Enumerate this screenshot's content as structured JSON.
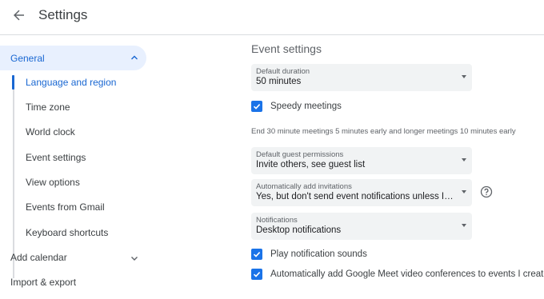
{
  "header": {
    "title": "Settings",
    "back_icon": "arrow-back-icon"
  },
  "sidebar": {
    "section": {
      "label": "General",
      "expanded": true
    },
    "items": [
      {
        "label": "Language and region",
        "active": true
      },
      {
        "label": "Time zone"
      },
      {
        "label": "World clock"
      },
      {
        "label": "Event settings"
      },
      {
        "label": "View options"
      },
      {
        "label": "Events from Gmail"
      },
      {
        "label": "Keyboard shortcuts"
      }
    ],
    "add_calendar": {
      "label": "Add calendar"
    },
    "import_export": {
      "label": "Import & export"
    }
  },
  "main": {
    "section_title": "Event settings",
    "default_duration": {
      "caption": "Default duration",
      "value": "50 minutes"
    },
    "speedy_meetings": {
      "label": "Speedy meetings",
      "checked": true
    },
    "speedy_hint": "End 30 minute meetings 5 minutes early and longer meetings 10 minutes early",
    "guest_permissions": {
      "caption": "Default guest permissions",
      "value": "Invite others, see guest list"
    },
    "auto_invitations": {
      "caption": "Automatically add invitations",
      "value": "Yes, but don't send event notifications unless I ha..."
    },
    "notifications": {
      "caption": "Notifications",
      "value": "Desktop notifications"
    },
    "play_sounds": {
      "label": "Play notification sounds",
      "checked": true
    },
    "auto_meet": {
      "label": "Automatically add Google Meet video conferences to events I create",
      "checked": true
    }
  },
  "colors": {
    "accent": "#1a73e8",
    "active_text": "#1967d2",
    "active_bg": "#e8f0fe",
    "field_bg": "#f1f3f4"
  }
}
